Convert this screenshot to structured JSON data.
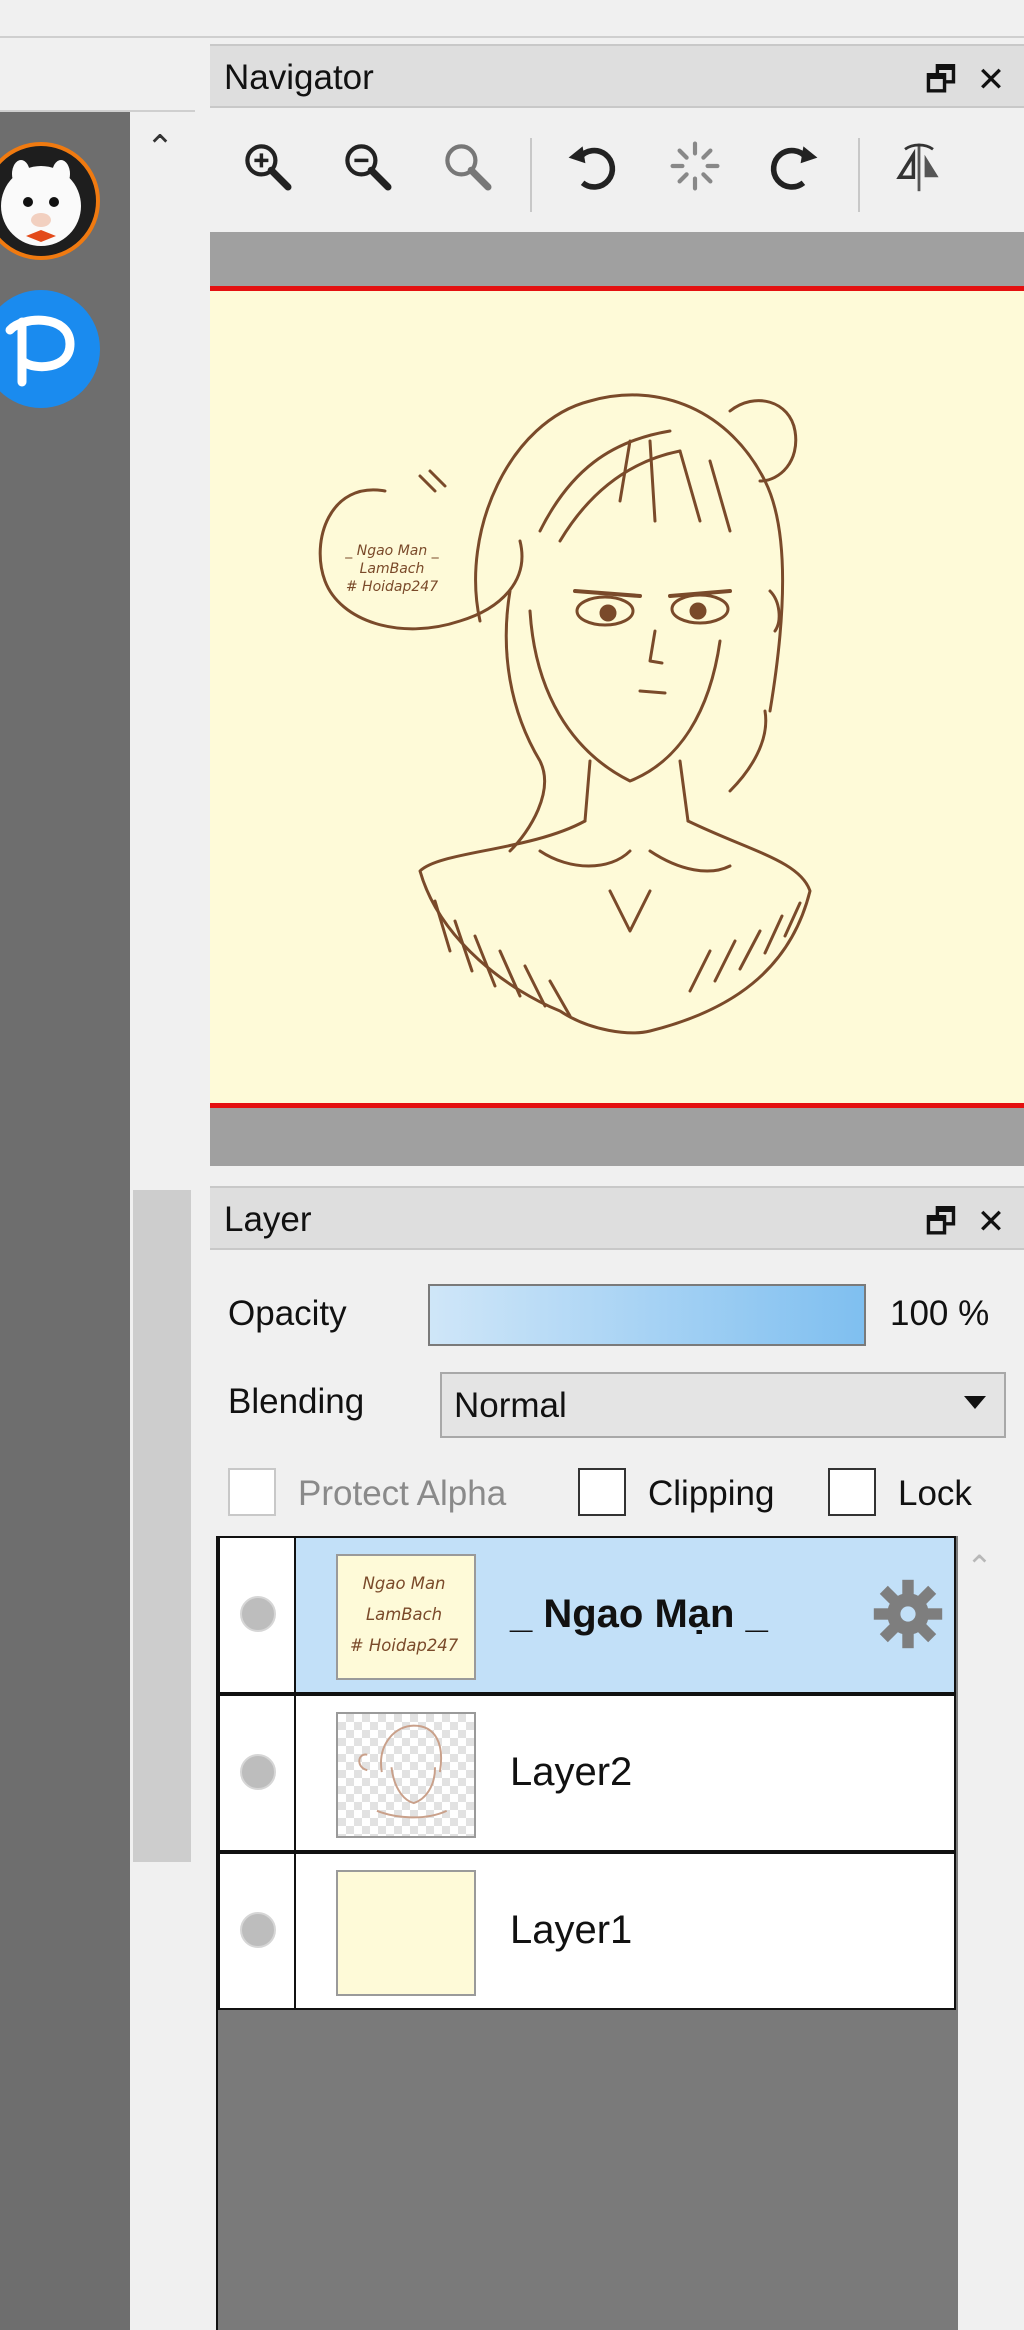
{
  "navigator": {
    "title": "Navigator",
    "tools": [
      "zoom-in-icon",
      "zoom-out-icon",
      "zoom-reset-icon",
      "rotate-left-icon",
      "rotate-reset-icon",
      "rotate-right-icon",
      "flip-horizontal-icon"
    ]
  },
  "panel_buttons": {
    "float": "🗗",
    "close": "✕"
  },
  "canvas_text": [
    "_ Ngao Man _",
    "LamBach",
    "# Hoidap247"
  ],
  "layer_panel": {
    "title": "Layer",
    "opacity_label": "Opacity",
    "opacity_value": "100 %",
    "opacity_fraction": 1.0,
    "blending_label": "Blending",
    "blending_value": "Normal",
    "checkboxes": {
      "protect_alpha": "Protect Alpha",
      "clipping": "Clipping",
      "lock": "Lock"
    },
    "layers": [
      {
        "name": "_ Ngao Mạn _",
        "selected": true,
        "thumb_text": [
          "Ngao Man",
          "LamBach",
          "# Hoidap247"
        ]
      },
      {
        "name": "Layer2",
        "selected": false
      },
      {
        "name": "Layer1",
        "selected": false
      }
    ]
  },
  "colors": {
    "accent": "#c2e0f8",
    "canvas_bg": "#fefad8",
    "frame_red": "#e41010",
    "ink": "#7a4a2a"
  }
}
